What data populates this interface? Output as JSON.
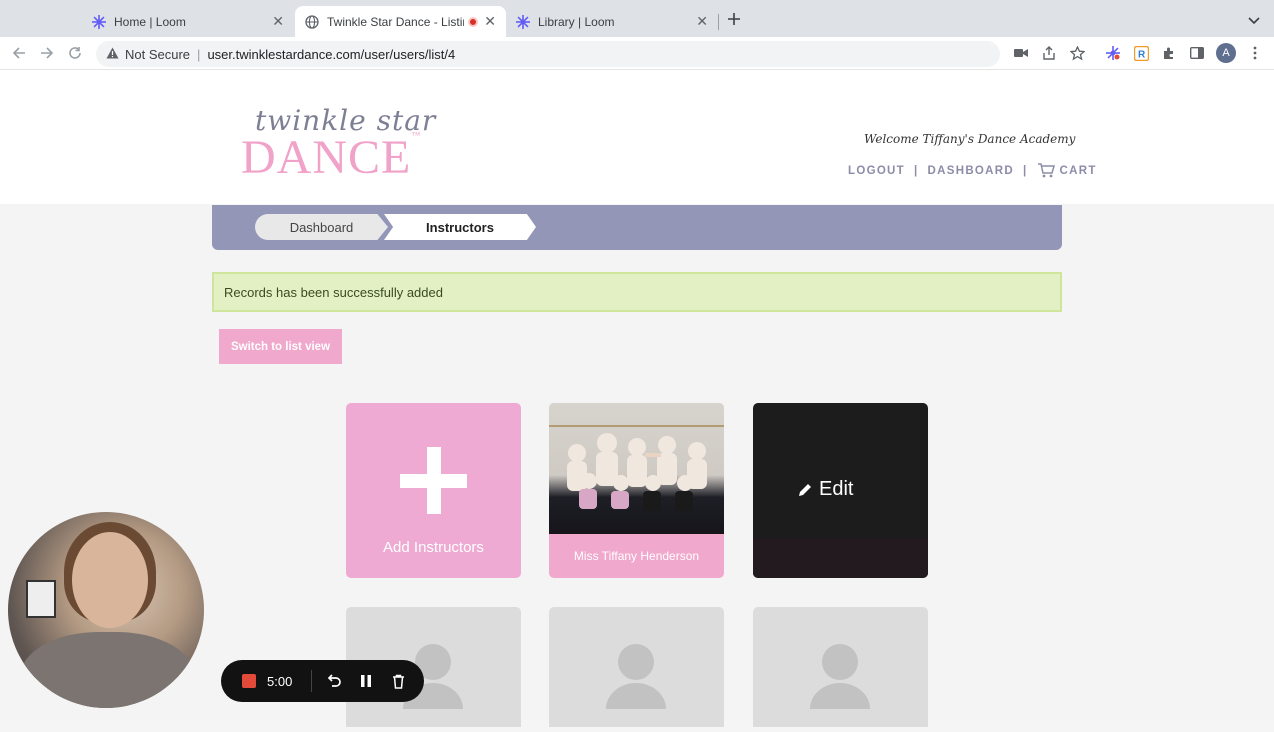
{
  "browser": {
    "tabs": [
      {
        "title": "Home | Loom",
        "active": false
      },
      {
        "title": "Twinkle Star Dance - Listin",
        "active": true,
        "recording": true
      },
      {
        "title": "Library | Loom",
        "active": false
      }
    ],
    "security_label": "Not Secure",
    "url": "user.twinklestardance.com/user/users/list/4",
    "profile_initial": "A"
  },
  "site": {
    "logo_script": "twinkle star",
    "logo_main": "DANCE",
    "logo_tm": "™",
    "welcome": "Welcome Tiffany's Dance Academy",
    "nav": {
      "logout": "LOGOUT",
      "dashboard": "DASHBOARD",
      "cart": "CART",
      "separator": "|"
    }
  },
  "breadcrumb": {
    "items": [
      "Dashboard",
      "Instructors"
    ]
  },
  "alert": {
    "message": "Records has been successfully added"
  },
  "switch_view": {
    "label": "Switch to list view"
  },
  "cards": {
    "add_label": "Add Instructors",
    "instructor_name": "Miss Tiffany Henderson",
    "edit_label": "Edit"
  },
  "loom": {
    "timer": "5:00"
  },
  "colors": {
    "accent_pink": "#f0a8cc",
    "crumb_bar": "#9496b8",
    "alert_bg": "#e3f0c4"
  }
}
